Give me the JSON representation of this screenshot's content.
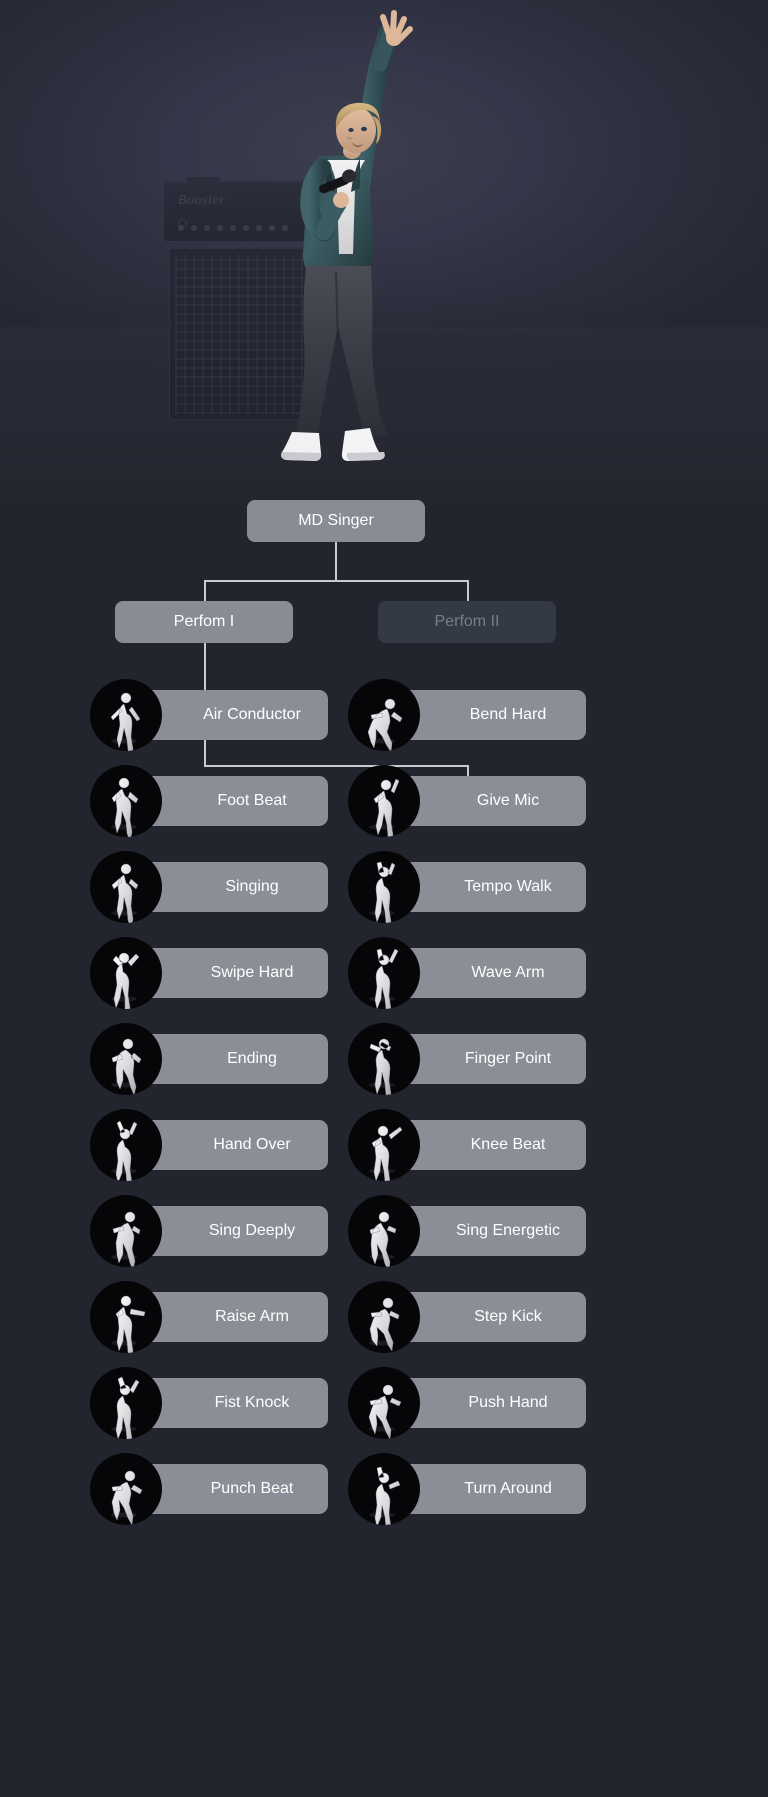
{
  "hero": {
    "amp_brand": "Booster",
    "scene": "stage-singer",
    "description": "3D male singer with blonde hair, teal jacket, white shirt, dark jeans, white sneakers, holding a microphone with right arm raised"
  },
  "colors": {
    "background": "#22242e",
    "hero_background": "#35374a",
    "pill_active": "#8b8e97",
    "pill_disabled": "#343a45",
    "pill_text": "#ffffff",
    "pill_text_disabled": "#787c88",
    "connector": "#c9cbd2",
    "thumb_background": "#060608"
  },
  "tree": {
    "root": {
      "label": "MD Singer",
      "enabled": true
    },
    "branches": [
      {
        "label": "Perfom I",
        "enabled": true
      },
      {
        "label": "Perfom II",
        "enabled": false
      }
    ]
  },
  "actions": {
    "left_column": [
      {
        "label": "Air Conductor",
        "icon": "pose-air-conductor-icon"
      },
      {
        "label": "Foot Beat",
        "icon": "pose-foot-beat-icon"
      },
      {
        "label": "Singing",
        "icon": "pose-singing-icon"
      },
      {
        "label": "Swipe Hard",
        "icon": "pose-swipe-hard-icon"
      },
      {
        "label": "Ending",
        "icon": "pose-ending-icon"
      },
      {
        "label": "Hand Over",
        "icon": "pose-hand-over-icon"
      },
      {
        "label": "Sing Deeply",
        "icon": "pose-sing-deeply-icon"
      },
      {
        "label": "Raise Arm",
        "icon": "pose-raise-arm-icon"
      },
      {
        "label": "Fist Knock",
        "icon": "pose-fist-knock-icon"
      },
      {
        "label": "Punch Beat",
        "icon": "pose-punch-beat-icon"
      }
    ],
    "right_column": [
      {
        "label": "Bend Hard",
        "icon": "pose-bend-hard-icon"
      },
      {
        "label": "Give Mic",
        "icon": "pose-give-mic-icon"
      },
      {
        "label": "Tempo Walk",
        "icon": "pose-tempo-walk-icon"
      },
      {
        "label": "Wave Arm",
        "icon": "pose-wave-arm-icon"
      },
      {
        "label": "Finger Point",
        "icon": "pose-finger-point-icon"
      },
      {
        "label": "Knee Beat",
        "icon": "pose-knee-beat-icon"
      },
      {
        "label": "Sing Energetic",
        "icon": "pose-sing-energetic-icon"
      },
      {
        "label": "Step Kick",
        "icon": "pose-step-kick-icon"
      },
      {
        "label": "Push Hand",
        "icon": "pose-push-hand-icon"
      },
      {
        "label": "Turn Around",
        "icon": "pose-turn-around-icon"
      }
    ]
  }
}
